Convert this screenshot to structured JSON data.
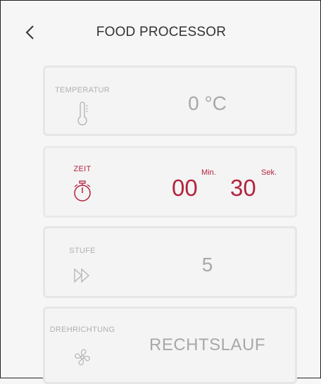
{
  "header": {
    "title": "FOOD PROCESSOR",
    "back_icon": "chevron-left-icon"
  },
  "cards": {
    "temperature": {
      "label": "TEMPERATUR",
      "value": "0 °C",
      "icon": "thermometer-icon"
    },
    "time": {
      "label": "ZEIT",
      "minutes": "00",
      "min_unit": "Min.",
      "seconds": "30",
      "sec_unit": "Sek.",
      "icon": "stopwatch-icon"
    },
    "speed": {
      "label": "STUFE",
      "value": "5",
      "icon": "fast-forward-icon"
    },
    "direction": {
      "label": "DREHRICHTUNG",
      "value": "RECHTSLAUF",
      "icon": "fan-icon"
    }
  },
  "colors": {
    "accent": "#b2243f",
    "inactive_text": "#a8a8a8",
    "card_border": "#e6e6e6"
  }
}
